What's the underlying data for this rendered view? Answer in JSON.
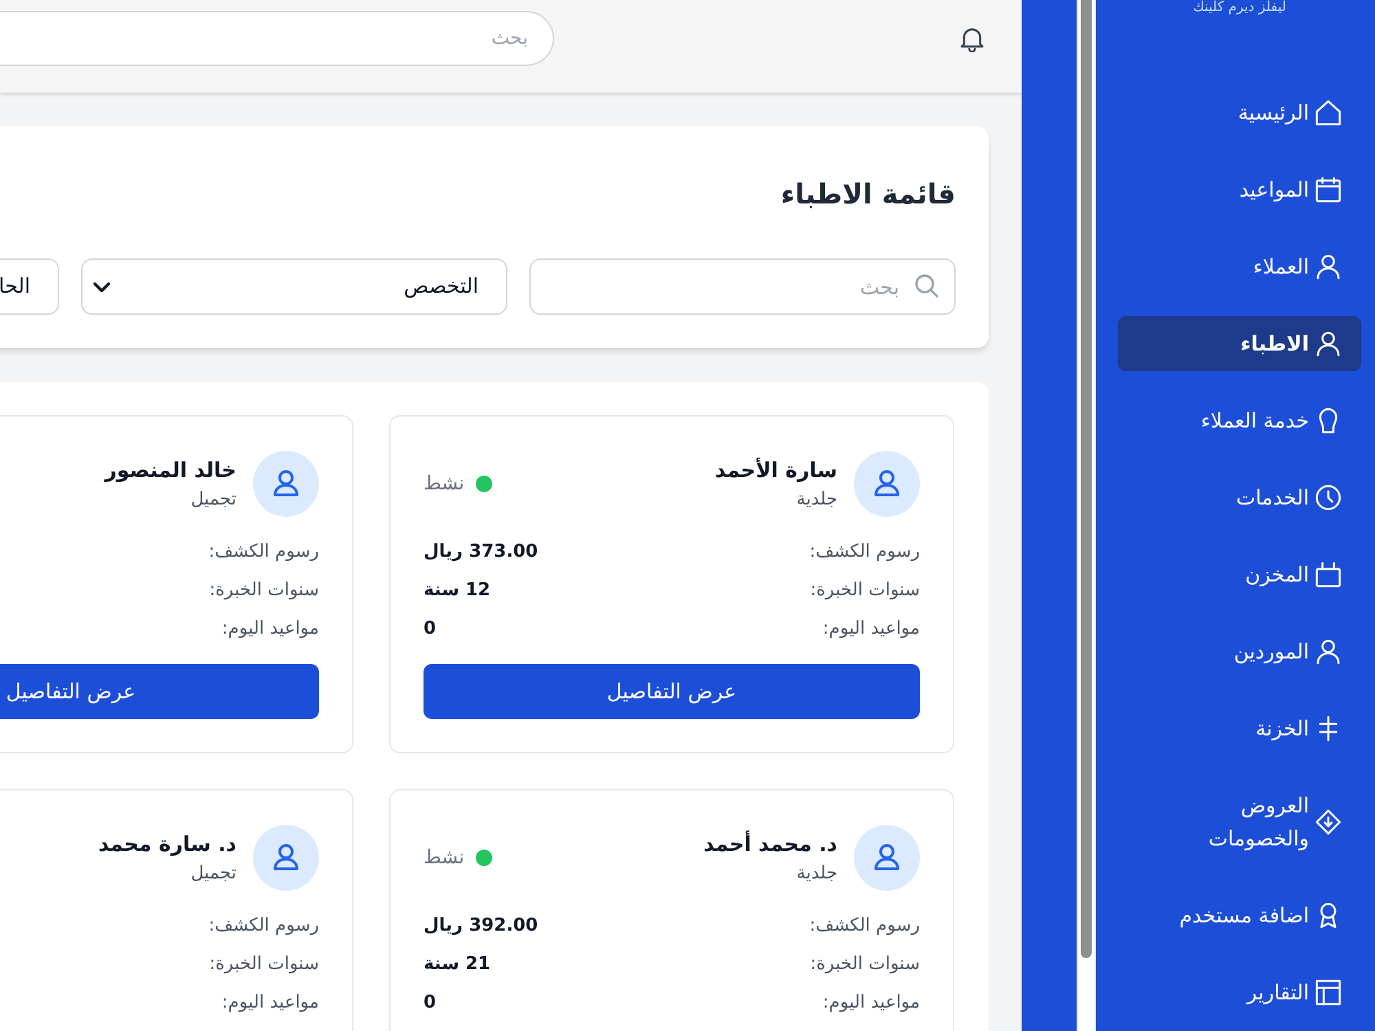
{
  "sidebar": {
    "brand": "ليفلز ديرم كلينك",
    "items": [
      {
        "label": "الرئيسية",
        "selected": false
      },
      {
        "label": "المواعيد",
        "selected": false
      },
      {
        "label": "العملاء",
        "selected": false
      },
      {
        "label": "الاطباء",
        "selected": true
      },
      {
        "label": "خدمة العملاء",
        "selected": false
      },
      {
        "label": "الخدمات",
        "selected": false
      },
      {
        "label": "المخزن",
        "selected": false
      },
      {
        "label": "الموردين",
        "selected": false
      },
      {
        "label": "الخزنة",
        "selected": false
      },
      {
        "label": "العروض والخصومات",
        "selected": false
      },
      {
        "label": "اضافة مستخدم",
        "selected": false
      },
      {
        "label": "التقارير",
        "selected": false
      }
    ]
  },
  "topbar": {
    "search": {
      "placeholder": "بحث"
    }
  },
  "page": {
    "title": "قائمة الاطباء",
    "filters": [
      {
        "kind": "search",
        "placeholder": "بحث"
      },
      {
        "kind": "select",
        "value": "التخصص"
      },
      {
        "kind": "select",
        "value": "الحا"
      }
    ]
  },
  "doctors": [
    {
      "name": "سارة الأحمد",
      "specialty": "جلدية",
      "status": {
        "label": "نشط",
        "active": true
      },
      "details": [
        {
          "label": "رسوم الكشف:",
          "value": "373.00 ريال"
        },
        {
          "label": "سنوات الخبرة:",
          "value": "12 سنة"
        },
        {
          "label": "مواعيد اليوم:",
          "value": "0"
        }
      ],
      "button": "عرض التفاصيل"
    },
    {
      "name": "خالد المنصور",
      "specialty": "تجميل",
      "details": [
        {
          "label": "رسوم الكشف:"
        },
        {
          "label": "سنوات الخبرة:"
        },
        {
          "label": "مواعيد اليوم:"
        }
      ],
      "button": "عرض التفاصيل"
    },
    {
      "name": "د. محمد أحمد",
      "specialty": "جلدية",
      "status": {
        "label": "نشط",
        "active": true
      },
      "details": [
        {
          "label": "رسوم الكشف:",
          "value": "392.00 ريال"
        },
        {
          "label": "سنوات الخبرة:",
          "value": "21 سنة"
        },
        {
          "label": "مواعيد اليوم:",
          "value": "0"
        }
      ]
    },
    {
      "name": "د. سارة محمد",
      "specialty": "تجميل",
      "details": [
        {
          "label": "رسوم الكشف:"
        },
        {
          "label": "سنوات الخبرة:"
        },
        {
          "label": "مواعيد اليوم:"
        }
      ]
    }
  ]
}
